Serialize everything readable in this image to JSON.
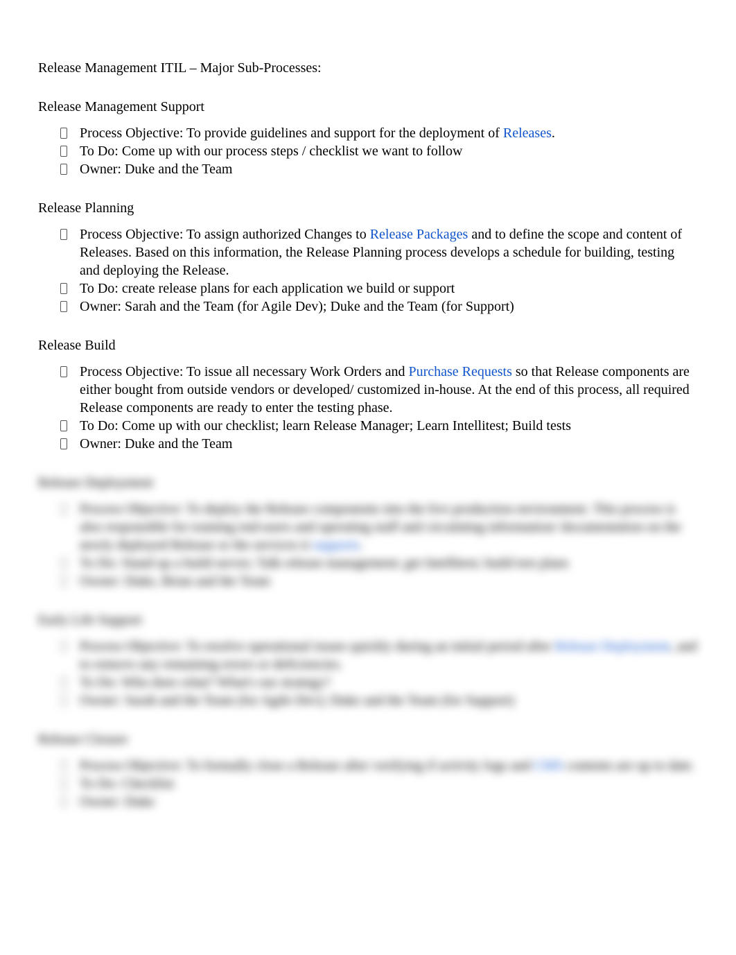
{
  "title": "Release Management ITIL – Major Sub-Processes:",
  "sections": {
    "s1": {
      "heading": "Release Management Support",
      "obj_pre": "Process Objective: To provide guidelines and support for the deployment of ",
      "obj_link": "Releases",
      "obj_post": ".",
      "todo": "To Do: Come up with our process steps / checklist we want to follow",
      "owner": "Owner: Duke and the Team"
    },
    "s2": {
      "heading": "Release Planning",
      "obj_pre": "Process Objective: To assign authorized Changes to ",
      "obj_link": "Release Packages",
      "obj_post": " and to define the scope and content of Releases. Based on this information, the Release Planning process develops a schedule for building, testing and deploying the Release.",
      "todo": "To Do: create release plans for each application we build or support",
      "owner": "Owner: Sarah and the Team (for Agile Dev); Duke and the Team (for Support)"
    },
    "s3": {
      "heading": "Release Build",
      "obj_pre": "Process Objective: To issue all necessary Work Orders and ",
      "obj_link": "Purchase Requests",
      "obj_post": " so that Release components are either bought from outside vendors or developed/ customized in-house. At the end of this process, all required Release components are ready to enter the testing phase.",
      "todo": "To Do: Come up with our checklist; learn Release Manager; Learn Intellitest; Build tests",
      "owner": "Owner: Duke and the Team"
    },
    "s4": {
      "heading": "Release Deployment",
      "obj_pre": "Process Objective: To deploy the Release components into the live production environment. This process is also responsible for training end-users and operating staff and circulating information/ documentation on the newly deployed Release or the services it ",
      "obj_link": "supports",
      "obj_post": ".",
      "todo": "To Do: Stand up a build server; Talk release management; get Intellitest; build test plans",
      "owner": "Owner: Duke, Brian and the Team"
    },
    "s5": {
      "heading": "Early Life Support",
      "obj_pre": "Process Objective: To resolve operational issues quickly during an initial period after ",
      "obj_link": "Release Deployment",
      "obj_post": ", and to remove any remaining errors or deficiencies.",
      "todo": "To Do: Who does what? What's our strategy?",
      "owner": "Owner: Sarah and the Team (for Agile Dev); Duke and the Team (for Support)"
    },
    "s6": {
      "heading": "Release Closure",
      "obj_pre": "Process Objective: To formally close a Release after verifying if activity logs and ",
      "obj_link": "CMS",
      "obj_post": " contents are up to date.",
      "todo": "To Do: Checklist",
      "owner": "Owner: Duke"
    }
  }
}
